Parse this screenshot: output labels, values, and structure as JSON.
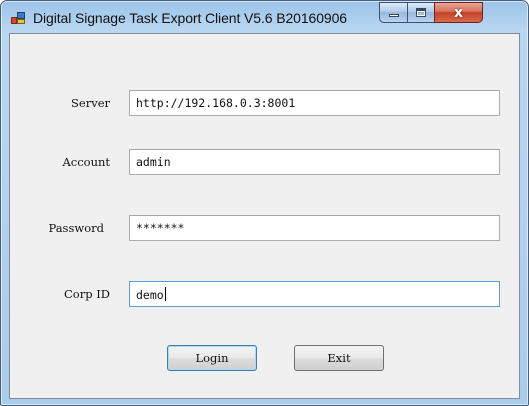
{
  "window": {
    "title": "Digital Signage Task Export Client V5.6 B20160906",
    "minimize_glyph": "",
    "close_glyph": "x"
  },
  "form": {
    "server": {
      "label": "Server",
      "value": "http://192.168.0.3:8001"
    },
    "account": {
      "label": "Account",
      "value": "admin"
    },
    "password": {
      "label": "Password",
      "value": "*******"
    },
    "corp_id": {
      "label": "Corp ID",
      "value": "demo"
    }
  },
  "buttons": {
    "login": "Login",
    "exit": "Exit"
  },
  "icons": {
    "app": "app-windows-icon",
    "minimize": "minimize-icon",
    "maximize": "maximize-icon",
    "close": "close-icon"
  },
  "colors": {
    "titlebar": "#b9d7f1",
    "client_bg": "#f0f0f0",
    "close_button": "#c2412a",
    "focus_border": "#5a9fd6"
  }
}
